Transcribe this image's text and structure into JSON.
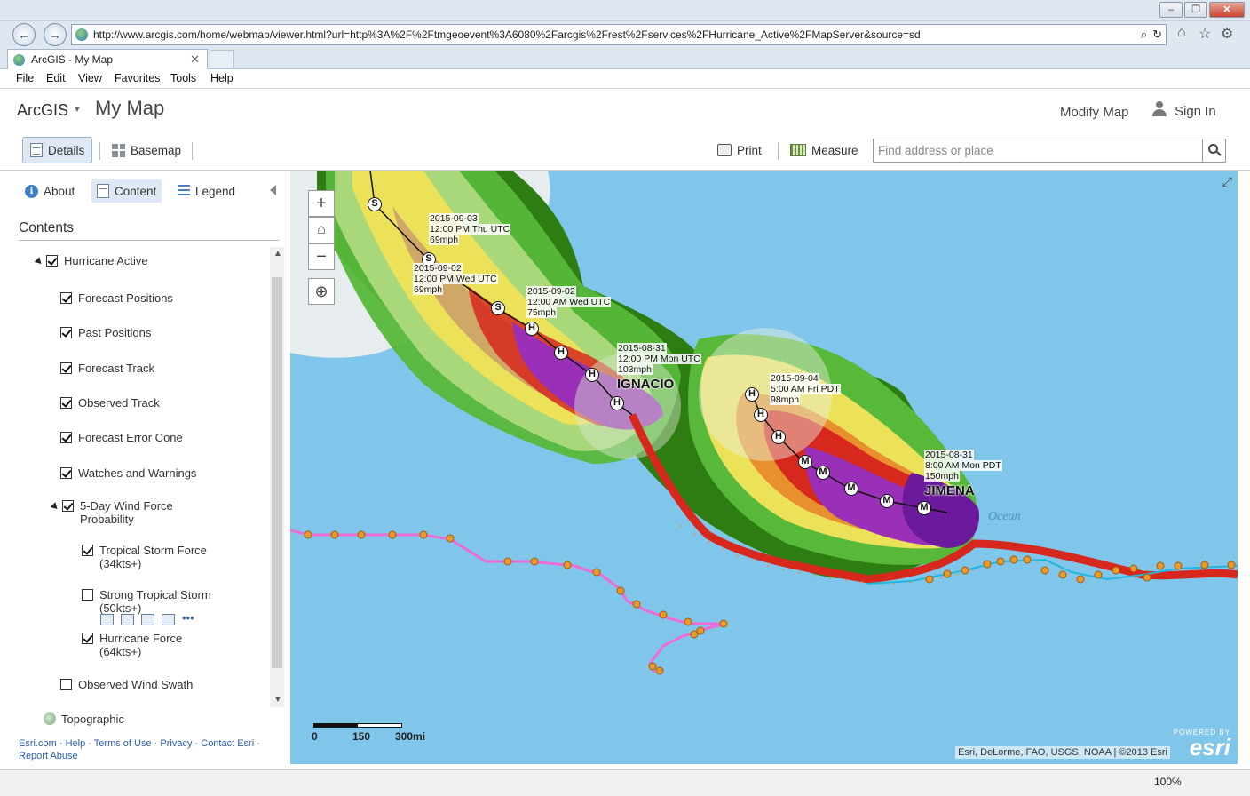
{
  "browser": {
    "url": "http://www.arcgis.com/home/webmap/viewer.html?url=http%3A%2F%2Ftmgeoevent%3A6080%2Farcgis%2Frest%2Fservices%2FHurricane_Active%2FMapServer&source=sd",
    "tab_title": "ArcGIS - My Map",
    "tab_close": "✕",
    "menu": [
      "File",
      "Edit",
      "View",
      "Favorites",
      "Tools",
      "Help"
    ],
    "zoom": "100%",
    "win_minimize": "–",
    "win_restore": "❐",
    "win_close": "✕",
    "back": "←",
    "forward": "→"
  },
  "app": {
    "brand": "ArcGIS",
    "map_title": "My Map",
    "modify_map": "Modify Map",
    "sign_in": "Sign In"
  },
  "toolbar": {
    "details": "Details",
    "basemap": "Basemap",
    "print": "Print",
    "measure": "Measure",
    "search_placeholder": "Find address or place"
  },
  "sidebar": {
    "tabs": {
      "about": "About",
      "content": "Content",
      "legend": "Legend"
    },
    "contents_title": "Contents",
    "layers": {
      "hurricane_active": "Hurricane Active",
      "forecast_positions": "Forecast Positions",
      "past_positions": "Past Positions",
      "forecast_track": "Forecast Track",
      "observed_track": "Observed Track",
      "forecast_error_cone": "Forecast Error Cone",
      "watches_warnings": "Watches and Warnings",
      "wind_force_l1": "5-Day Wind Force",
      "wind_force_l2": "Probability",
      "tropical_l1": "Tropical Storm Force",
      "tropical_l2": "(34kts+)",
      "strong_l1": "Strong Tropical Storm",
      "strong_l2": "(50kts+)",
      "hurricane_l1": "Hurricane Force",
      "hurricane_l2": "(64kts+)",
      "observed_wind_swath": "Observed Wind Swath",
      "topographic": "Topographic"
    },
    "footer": {
      "esri": "Esri.com",
      "help": "Help",
      "terms": "Terms of Use",
      "privacy": "Privacy",
      "contact": "Contact Esri",
      "report": "Report Abuse",
      "sep": "·"
    }
  },
  "map": {
    "storms": {
      "ignacio": "IGNACIO",
      "jimena": "JIMENA"
    },
    "ocean_label": "Ocean",
    "callouts": {
      "c1": {
        "date": "2015-09-03",
        "time": "12:00 PM Thu UTC",
        "speed": "69mph"
      },
      "c2": {
        "date": "2015-09-02",
        "time": "12:00 PM Wed UTC",
        "speed": "69mph"
      },
      "c3": {
        "date": "2015-09-02",
        "time": "12:00 AM Wed UTC",
        "speed": "75mph"
      },
      "c4": {
        "date": "2015-08-31",
        "time": "12:00 PM Mon UTC",
        "speed": "103mph"
      },
      "c5": {
        "date": "2015-09-04",
        "time": "5:00 AM Fri PDT",
        "speed": "98mph"
      },
      "c6": {
        "date": "2015-08-31",
        "time": "8:00 AM Mon PDT",
        "speed": "150mph"
      }
    },
    "markers": {
      "s": "S",
      "h": "H",
      "m": "M"
    },
    "scale": {
      "a": "0",
      "b": "150",
      "c": "300mi"
    },
    "attribution": "Esri, DeLorme, FAO, USGS, NOAA | ©2013 Esri",
    "esri_powered": "POWERED BY",
    "esri_name": "esri",
    "zoom_in": "+",
    "zoom_out": "−"
  },
  "colors": {
    "cone_dark_green": "#2e7d12",
    "cone_green": "#57b83a",
    "cone_light_green": "#a9d87a",
    "cone_yellow": "#ece25a",
    "cone_orange": "#e8902e",
    "cone_red": "#d7281e",
    "cone_purple": "#9a2fb8",
    "track_magenta": "#ee6ad8",
    "ocean": "#7fc6ea"
  }
}
